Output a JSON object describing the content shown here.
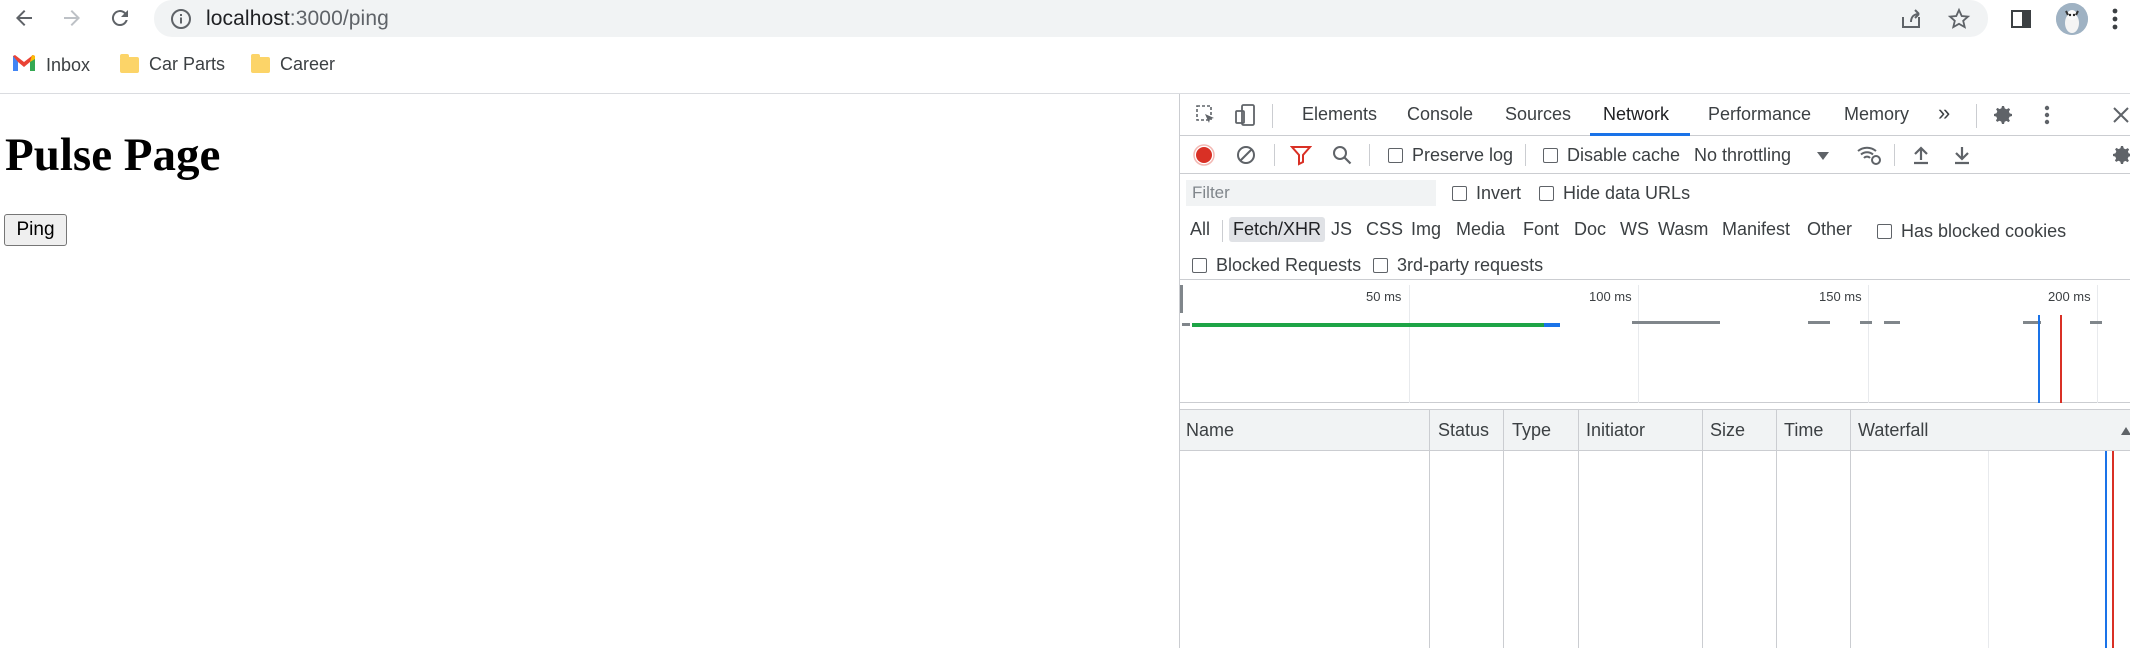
{
  "browser": {
    "url_host": "localhost",
    "url_path": ":3000/ping",
    "bookmarks": [
      {
        "label": "Inbox",
        "icon": "gmail-icon"
      },
      {
        "label": "Car Parts",
        "icon": "folder-icon"
      },
      {
        "label": "Career",
        "icon": "folder-icon"
      }
    ]
  },
  "page": {
    "title": "Pulse Page",
    "ping_button": "Ping"
  },
  "devtools": {
    "tabs": [
      "Elements",
      "Console",
      "Sources",
      "Network",
      "Performance",
      "Memory"
    ],
    "active_tab": "Network",
    "overflow": "»",
    "controls": {
      "preserve_log": "Preserve log",
      "disable_cache": "Disable cache",
      "throttling": "No throttling"
    },
    "filter": {
      "placeholder": "Filter",
      "invert": "Invert",
      "hide_data_urls": "Hide data URLs"
    },
    "types": [
      "All",
      "Fetch/XHR",
      "JS",
      "CSS",
      "Img",
      "Media",
      "Font",
      "Doc",
      "WS",
      "Wasm",
      "Manifest",
      "Other"
    ],
    "active_type": "Fetch/XHR",
    "has_blocked_cookies": "Has blocked cookies",
    "blocked_requests": "Blocked Requests",
    "third_party": "3rd-party requests",
    "timeline_ticks": [
      "50 ms",
      "100 ms",
      "150 ms",
      "200 ms"
    ],
    "columns": [
      "Name",
      "Status",
      "Type",
      "Initiator",
      "Size",
      "Time",
      "Waterfall"
    ],
    "colors": {
      "accent": "#1a73e8",
      "record": "#d93025",
      "filter_active": "#d93025",
      "green_bar": "#1ea446"
    }
  }
}
